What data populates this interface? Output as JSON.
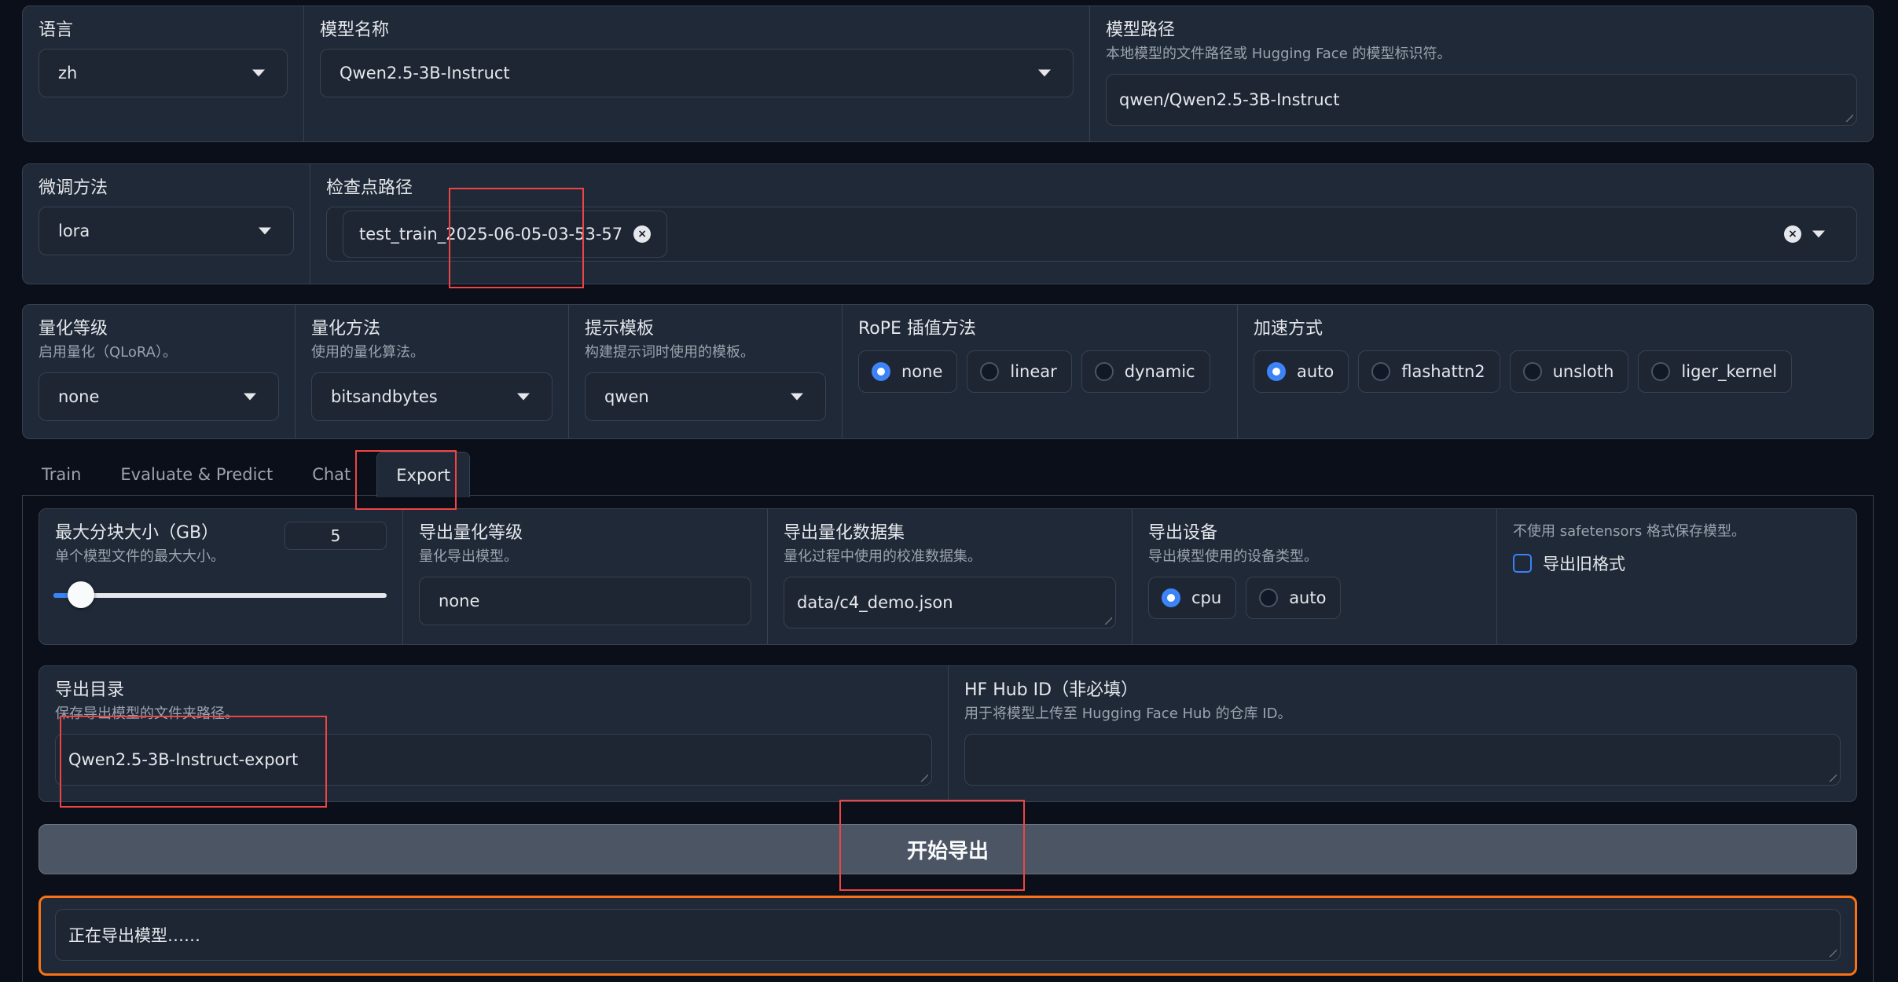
{
  "top_row": {
    "language": {
      "label": "语言",
      "value": "zh"
    },
    "model_name": {
      "label": "模型名称",
      "value": "Qwen2.5-3B-Instruct"
    },
    "model_path": {
      "label": "模型路径",
      "description": "本地模型的文件路径或 Hugging Face 的模型标识符。",
      "value": "qwen/Qwen2.5-3B-Instruct"
    }
  },
  "second_row": {
    "finetune": {
      "label": "微调方法",
      "value": "lora"
    },
    "checkpoint": {
      "label": "检查点路径",
      "chip": "test_train_2025-06-05-03-53-57",
      "chip_remove": "×",
      "clear": "×"
    }
  },
  "third_row": {
    "quant_level": {
      "label": "量化等级",
      "description": "启用量化（QLoRA）。",
      "value": "none"
    },
    "quant_method": {
      "label": "量化方法",
      "description": "使用的量化算法。",
      "value": "bitsandbytes"
    },
    "template": {
      "label": "提示模板",
      "description": "构建提示词时使用的模板。",
      "value": "qwen"
    },
    "rope": {
      "label": "RoPE 插值方法",
      "options": [
        "none",
        "linear",
        "dynamic"
      ],
      "selected": "none"
    },
    "booster": {
      "label": "加速方式",
      "options": [
        "auto",
        "flashattn2",
        "unsloth",
        "liger_kernel"
      ],
      "selected": "auto"
    }
  },
  "tabs": [
    "Train",
    "Evaluate & Predict",
    "Chat",
    "Export"
  ],
  "active_tab": "Export",
  "export": {
    "max_shard": {
      "label": "最大分块大小（GB）",
      "description": "单个模型文件的最大大小。",
      "value": "5",
      "slider_fraction": 0.05
    },
    "export_quant": {
      "label": "导出量化等级",
      "description": "量化导出模型。",
      "value": "none"
    },
    "export_dataset": {
      "label": "导出量化数据集",
      "description": "量化过程中使用的校准数据集。",
      "value": "data/c4_demo.json"
    },
    "export_device": {
      "label": "导出设备",
      "description": "导出模型使用的设备类型。",
      "options": [
        "cpu",
        "auto"
      ],
      "selected": "cpu"
    },
    "legacy": {
      "description": "不使用 safetensors 格式保存模型。",
      "label": "导出旧格式"
    },
    "export_dir": {
      "label": "导出目录",
      "description": "保存导出模型的文件夹路径。",
      "value": "Qwen2.5-3B-Instruct-export"
    },
    "hub_id": {
      "label": "HF Hub ID（非必填）",
      "description": "用于将模型上传至 Hugging Face Hub 的仓库 ID。",
      "value": ""
    },
    "start_button": "开始导出",
    "output": "正在导出模型……"
  },
  "colors": {
    "accent": "#3b82f6",
    "highlight": "#ef4444",
    "output_border": "#f97316"
  }
}
